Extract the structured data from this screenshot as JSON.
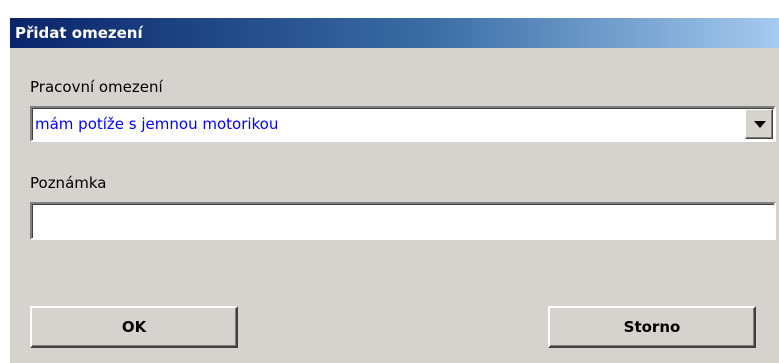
{
  "dialog": {
    "title": "Přidat omezení",
    "fields": {
      "work_constraint": {
        "label": "Pracovní omezení",
        "value": "mám potíže s jemnou motorikou"
      },
      "note": {
        "label": "Poznámka",
        "value": ""
      }
    },
    "buttons": {
      "ok_label": "OK",
      "cancel_label": "Storno"
    }
  },
  "colors": {
    "dialog_bg": "#d6d3ce",
    "title_gradient_start": "#0a246a",
    "title_gradient_end": "#a6caf0",
    "selected_value_text": "#0000ff"
  },
  "icons": {
    "dropdown": "chevron-down-icon"
  }
}
